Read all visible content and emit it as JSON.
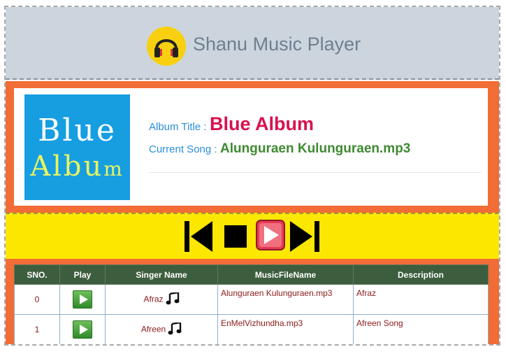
{
  "header": {
    "title": "Shanu Music Player",
    "logo_icon": "headphones-icon"
  },
  "album": {
    "art_line1": "Blue",
    "art_line2": "Albu",
    "art_line2_small": "m",
    "title_label": "Album Title :",
    "title_value": "Blue Album",
    "song_label": "Current Song :",
    "song_value": "Alunguraen Kulunguraen.mp3"
  },
  "controls": {
    "icons": [
      "skip-previous-icon",
      "stop-icon",
      "play-icon",
      "skip-next-icon"
    ]
  },
  "table": {
    "columns": [
      "SNO.",
      "Play",
      "Singer Name",
      "MusicFileName",
      "Description"
    ],
    "rows": [
      {
        "sno": "0",
        "singer": "Afraz",
        "file": "Alunguraen Kulunguraen.mp3",
        "description": "Afraz"
      },
      {
        "sno": "1",
        "singer": "Afreen",
        "file": "EnMelVizhundha.mp3",
        "description": "Afreen Song"
      }
    ]
  },
  "colors": {
    "accent_orange": "#f26c35",
    "control_yellow": "#fce700",
    "header_gray": "#ccd5de",
    "album_title_red": "#d8134f",
    "song_green": "#3e8a31",
    "table_header_green": "#3d5e3e"
  }
}
